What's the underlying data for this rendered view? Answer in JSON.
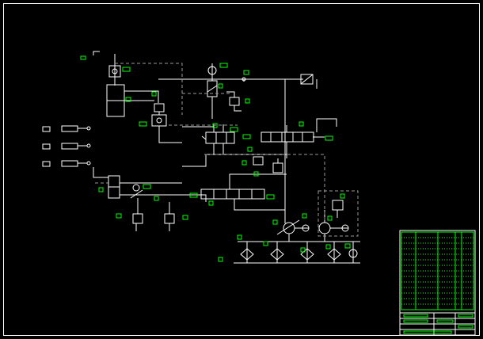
{
  "drawing": {
    "background": "#000000",
    "line_color": "#ffffff",
    "label_color": "#00ff00",
    "dashed_color": "#9a9a9a",
    "frame_color": "#ffffff"
  },
  "components": {
    "cylinders": [
      "clamp-cylinder",
      "feed-cylinder"
    ],
    "directional_valves": [
      "4-3-directional-valve-upper",
      "4-3-directional-valve-lower",
      "4-3-directional-valve-right"
    ],
    "pumps": [
      "pump-left",
      "pump-right"
    ],
    "filters_and_coolers": [
      "filter-1",
      "filter-2",
      "filter-3",
      "filter-4",
      "filter-5"
    ],
    "pressure_valves": [
      "relief-valve",
      "pressure-reducing-valve",
      "sequence-valve-1",
      "sequence-valve-2",
      "throttle-valve"
    ],
    "actuation_legend": [
      "legend-switch-1",
      "legend-switch-2",
      "legend-switch-3"
    ]
  }
}
